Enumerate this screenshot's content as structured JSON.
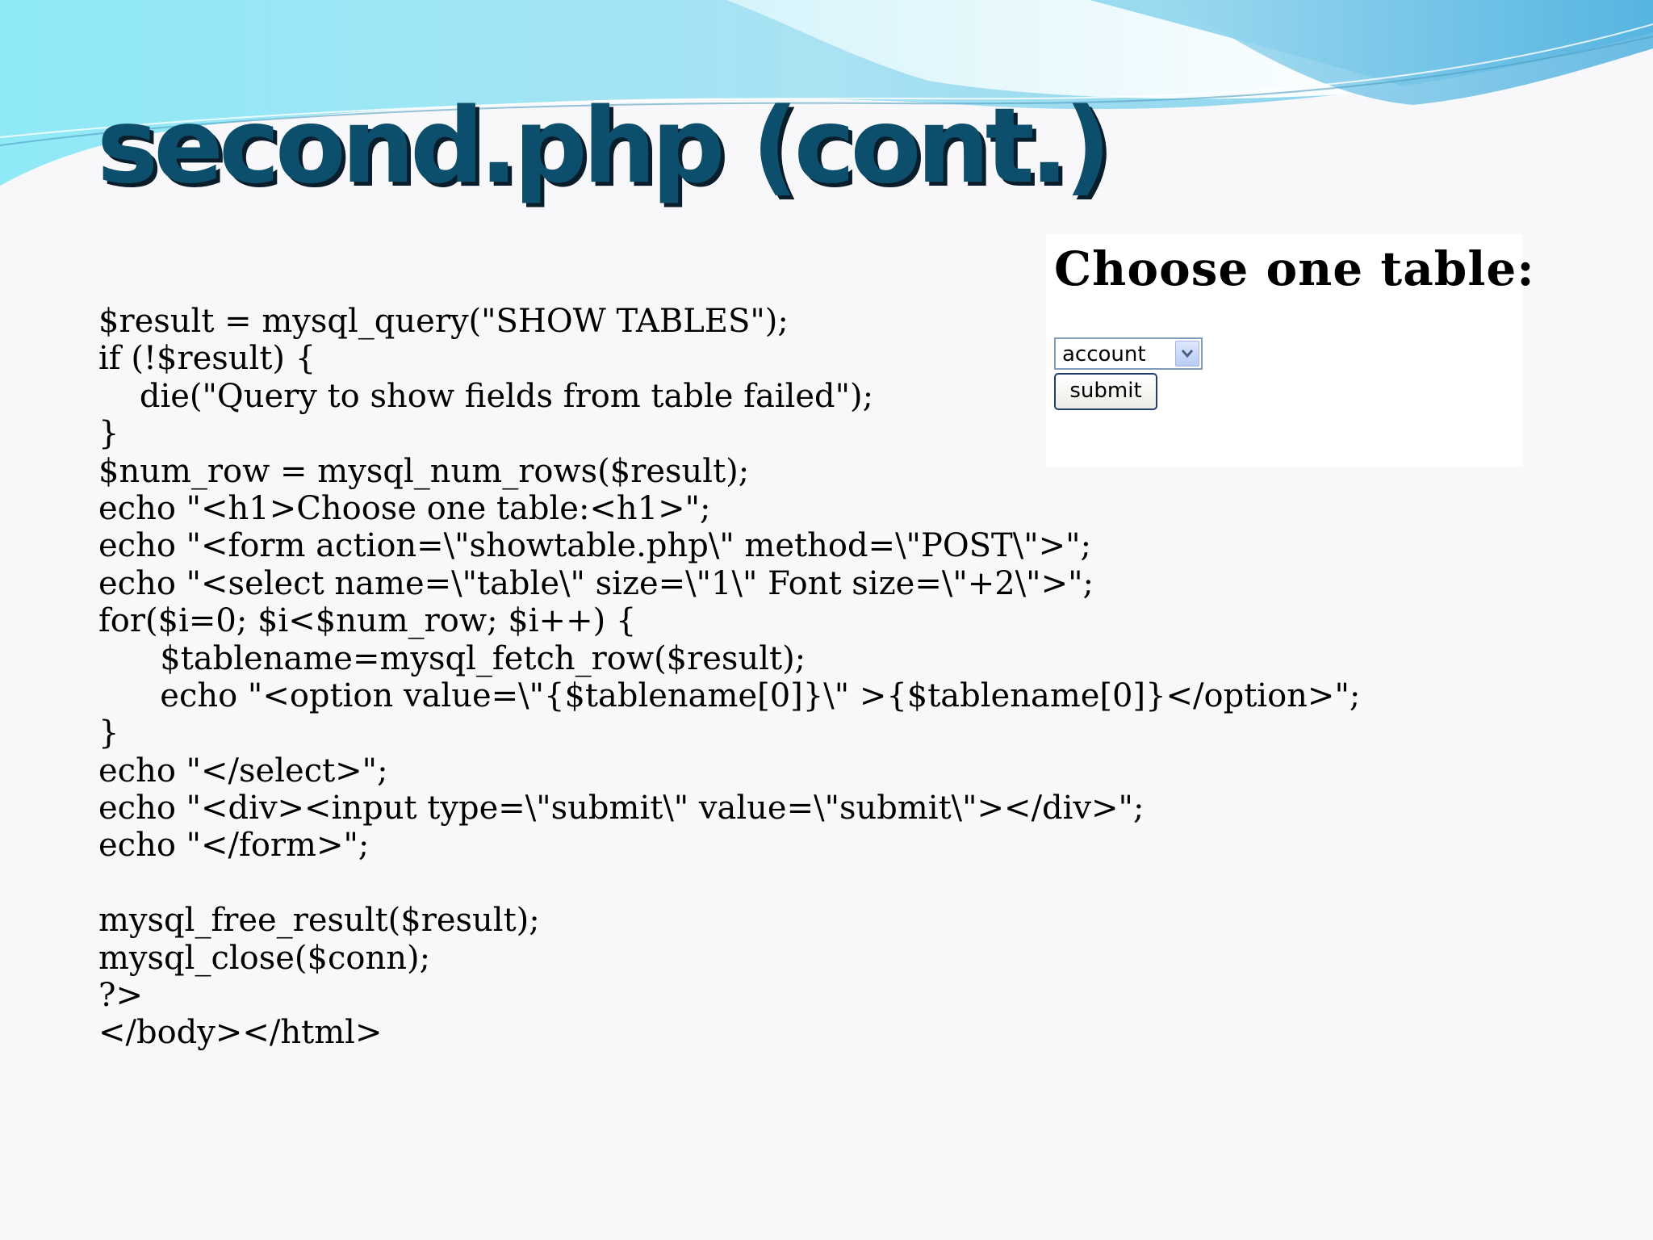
{
  "slide": {
    "title": "second.php (cont.)",
    "code_lines": [
      "$result = mysql_query(\"SHOW TABLES\");",
      "if (!$result) {",
      "    die(\"Query to show fields from table failed\");",
      "}",
      "$num_row = mysql_num_rows($result);",
      "echo \"<h1>Choose one table:<h1>\";",
      "echo \"<form action=\\\"showtable.php\\\" method=\\\"POST\\\">\";",
      "echo \"<select name=\\\"table\\\" size=\\\"1\\\" Font size=\\\"+2\\\">\";",
      "for($i=0; $i<$num_row; $i++) {",
      "      $tablename=mysql_fetch_row($result);",
      "      echo \"<option value=\\\"{$tablename[0]}\\\" >{$tablename[0]}</option>\";",
      "}",
      "echo \"</select>\";",
      "echo \"<div><input type=\\\"submit\\\" value=\\\"submit\\\"></div>\";",
      "echo \"</form>\";",
      "",
      "mysql_free_result($result);",
      "mysql_close($conn);",
      "?>",
      "</body></html>"
    ]
  },
  "preview": {
    "heading": "Choose one table:",
    "select_value": "account",
    "submit_label": "submit"
  },
  "colors": {
    "title": "#0b4f6c",
    "wave_light": "#a8ecf6",
    "wave_dark": "#5fb6e0"
  },
  "icons": {
    "dropdown": "chevron-down-icon"
  }
}
